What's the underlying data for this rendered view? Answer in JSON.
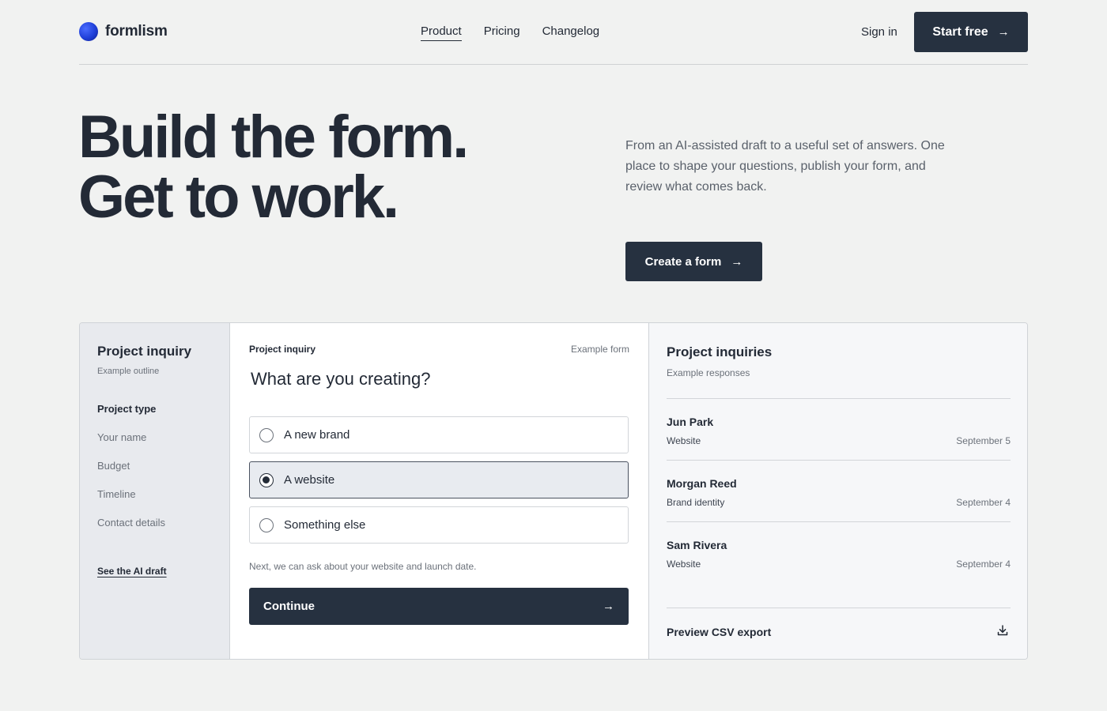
{
  "header": {
    "brand": "formlism",
    "nav": [
      {
        "label": "Product",
        "active": true
      },
      {
        "label": "Pricing",
        "active": false
      },
      {
        "label": "Changelog",
        "active": false
      }
    ],
    "signin_label": "Sign in",
    "start_label": "Start free"
  },
  "hero": {
    "title_line1": "Build the form.",
    "title_line2": "Get to work.",
    "description": "From an AI-assisted draft to a useful set of answers. One place to shape your questions, publish your form, and review what comes back.",
    "cta_label": "Create a form"
  },
  "outline": {
    "title": "Project inquiry",
    "subtitle": "Example outline",
    "items": [
      "Project type",
      "Your name",
      "Budget",
      "Timeline",
      "Contact details"
    ],
    "current_index": 0,
    "link_label": "See the AI draft"
  },
  "form": {
    "name": "Project inquiry",
    "tag": "Example form",
    "question": "What are you creating?",
    "options": [
      {
        "label": "A new brand",
        "selected": false
      },
      {
        "label": "A website",
        "selected": true
      },
      {
        "label": "Something else",
        "selected": false
      }
    ],
    "hint": "Next, we can ask about your website and launch date.",
    "continue_label": "Continue"
  },
  "responses": {
    "title": "Project inquiries",
    "subtitle": "Example responses",
    "rows": [
      {
        "name": "Jun Park",
        "type": "Website",
        "date": "September 5"
      },
      {
        "name": "Morgan Reed",
        "type": "Brand identity",
        "date": "September 4"
      },
      {
        "name": "Sam Rivera",
        "type": "Website",
        "date": "September 4"
      }
    ],
    "export_label": "Preview CSV export"
  },
  "icons": {
    "brand_logo": "gradient-circle-logo",
    "arrow": "arrow-right-icon",
    "download": "download-icon"
  },
  "colors": {
    "background": "#f1f2f1",
    "primary": "#263140",
    "text": "#232a36",
    "muted": "#6b717a",
    "brand_blue": "#1f3fd8"
  }
}
